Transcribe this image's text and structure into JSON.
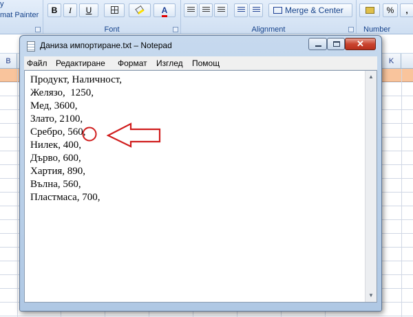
{
  "excel": {
    "ribbon": {
      "clipboard": {
        "top_text": "y",
        "format_painter": "mat Painter"
      },
      "font": {
        "label": "Font",
        "bold": "B",
        "italic": "I",
        "underline": "U",
        "font_color_letter": "A"
      },
      "alignment": {
        "label": "Alignment",
        "merge_center": "Merge & Center"
      },
      "number": {
        "label": "Number",
        "percent": "%"
      }
    },
    "columns": [
      "B",
      "K"
    ],
    "header_color": "#f9c49c"
  },
  "notepad": {
    "title": "Даниза импортиране.txt – Notepad",
    "menu": [
      "Файл",
      "Редактиране",
      "Формат",
      "Изглед",
      "Помощ"
    ],
    "lines": [
      "Продукт, Наличност,",
      "Желязо,  1250,",
      "Мед, 3600,",
      "Злато, 2100,",
      "Сребро, 560,",
      "Нилек, 400,",
      "Дърво, 600,",
      "Хартия, 890,",
      "Вълна, 560,",
      "Пластмаса, 700,"
    ],
    "icons": [
      "notepad-icon",
      "minimize-icon",
      "maximize-icon",
      "close-icon"
    ]
  },
  "annotation": {
    "color": "#d01c1c",
    "marks": [
      "circle-around-trailing-comma",
      "arrow-pointing-left"
    ]
  }
}
